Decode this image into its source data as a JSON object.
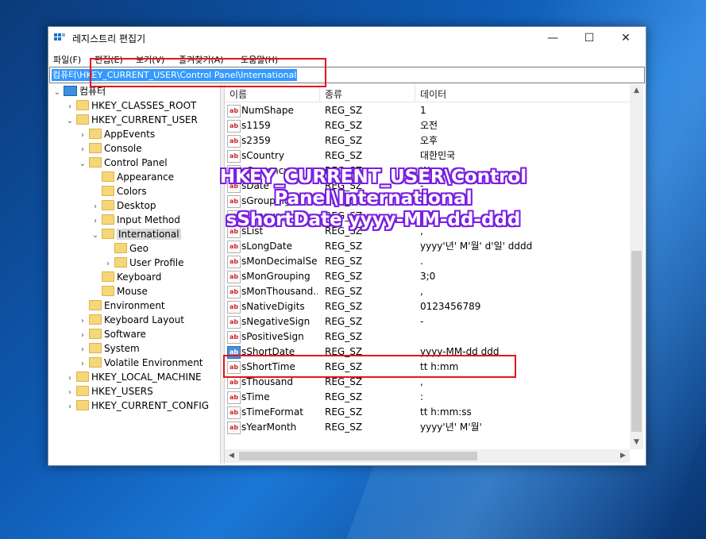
{
  "window": {
    "title": "레지스트리 편집기",
    "minimize_glyph": "—",
    "maximize_glyph": "☐",
    "close_glyph": "✕"
  },
  "menu": [
    {
      "label": "파일(F)"
    },
    {
      "label": "편집(E)"
    },
    {
      "label": "보기(V)"
    },
    {
      "label": "즐겨찾기(A)"
    },
    {
      "label": "도움말(H)"
    }
  ],
  "address": "컴퓨터\\HKEY_CURRENT_USER\\Control Panel\\International",
  "tree": {
    "root": "컴퓨터",
    "nodes": [
      {
        "label": "HKEY_CLASSES_ROOT"
      },
      {
        "label": "HKEY_CURRENT_USER"
      },
      {
        "label": "AppEvents"
      },
      {
        "label": "Console"
      },
      {
        "label": "Control Panel"
      },
      {
        "label": "Appearance"
      },
      {
        "label": "Colors"
      },
      {
        "label": "Desktop"
      },
      {
        "label": "Input Method"
      },
      {
        "label": "International"
      },
      {
        "label": "Geo"
      },
      {
        "label": "User Profile"
      },
      {
        "label": "Keyboard"
      },
      {
        "label": "Mouse"
      },
      {
        "label": "Environment"
      },
      {
        "label": "Keyboard Layout"
      },
      {
        "label": "Software"
      },
      {
        "label": "System"
      },
      {
        "label": "Volatile Environment"
      },
      {
        "label": "HKEY_LOCAL_MACHINE"
      },
      {
        "label": "HKEY_USERS"
      },
      {
        "label": "HKEY_CURRENT_CONFIG"
      }
    ],
    "expand_collapsed": "›",
    "expand_open": "⌄"
  },
  "list": {
    "headers": {
      "name": "이름",
      "type": "종류",
      "data": "데이터"
    },
    "value_icon_text": "ab",
    "rows": [
      {
        "name": "NumShape",
        "type": "REG_SZ",
        "data": "1"
      },
      {
        "name": "s1159",
        "type": "REG_SZ",
        "data": "오전"
      },
      {
        "name": "s2359",
        "type": "REG_SZ",
        "data": "오후"
      },
      {
        "name": "sCountry",
        "type": "REG_SZ",
        "data": "대한민국"
      },
      {
        "name": "sCurrency",
        "type": "REG_SZ",
        "data": "₩"
      },
      {
        "name": "sDate",
        "type": "REG_SZ",
        "data": "-"
      },
      {
        "name": "sGrouping",
        "type": "REG_SZ",
        "data": "3;0"
      },
      {
        "name": "sLanguage",
        "type": "REG_SZ",
        "data": "KOR"
      },
      {
        "name": "sList",
        "type": "REG_SZ",
        "data": ","
      },
      {
        "name": "sLongDate",
        "type": "REG_SZ",
        "data": "yyyy'년' M'월' d'일' dddd"
      },
      {
        "name": "sMonDecimalSep",
        "type": "REG_SZ",
        "data": "."
      },
      {
        "name": "sMonGrouping",
        "type": "REG_SZ",
        "data": "3;0"
      },
      {
        "name": "sMonThousand...",
        "type": "REG_SZ",
        "data": ","
      },
      {
        "name": "sNativeDigits",
        "type": "REG_SZ",
        "data": "0123456789"
      },
      {
        "name": "sNegativeSign",
        "type": "REG_SZ",
        "data": "-"
      },
      {
        "name": "sPositiveSign",
        "type": "REG_SZ",
        "data": ""
      },
      {
        "name": "sShortDate",
        "type": "REG_SZ",
        "data": "yyyy-MM-dd ddd"
      },
      {
        "name": "sShortTime",
        "type": "REG_SZ",
        "data": "tt h:mm"
      },
      {
        "name": "sThousand",
        "type": "REG_SZ",
        "data": ","
      },
      {
        "name": "sTime",
        "type": "REG_SZ",
        "data": ":"
      },
      {
        "name": "sTimeFormat",
        "type": "REG_SZ",
        "data": "tt h:mm:ss"
      },
      {
        "name": "sYearMonth",
        "type": "REG_SZ",
        "data": "yyyy'년' M'월'"
      }
    ]
  },
  "scroll_glyphs": {
    "up": "▲",
    "down": "▼",
    "left": "◀",
    "right": "▶"
  },
  "overlay": {
    "line1": "HKEY_CURRENT_USER\\Control Panel\\International",
    "line2": "sShortDate  yyyy-MM-dd-ddd"
  },
  "colors": {
    "highlight_box": "#e5141e",
    "overlay_outline": "#7a1fe0",
    "selection": "#3399ff"
  }
}
